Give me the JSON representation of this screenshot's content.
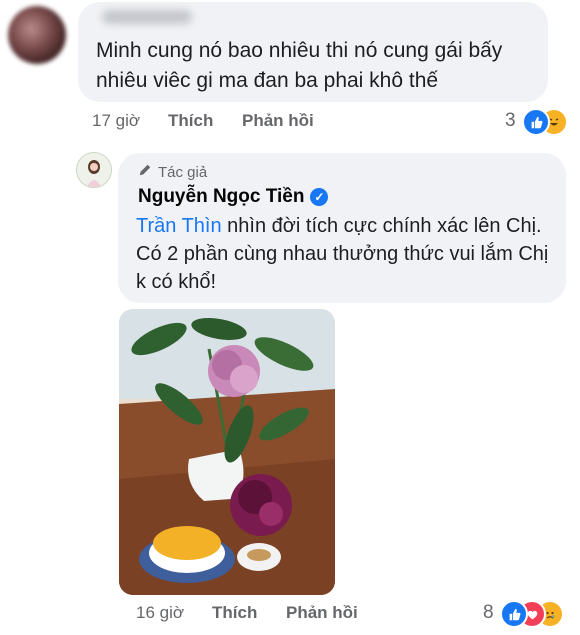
{
  "comment1": {
    "text": "Minh cung nó bao nhiêu thi nó cung gái bấy nhiêu viêc gi ma đan ba phai khô thế",
    "time": "17 giờ",
    "like_label": "Thích",
    "reply_label": "Phản hồi",
    "reaction_count": "3"
  },
  "comment2": {
    "author_tag": "Tác giả",
    "author_name": "Nguyễn Ngọc Tiền",
    "mention": "Trần Thìn",
    "text": " nhìn đời tích cực chính xác lên Chị. Có 2 phần cùng nhau thưởng thức vui lắm Chị k có khổ!",
    "time": "16 giờ",
    "like_label": "Thích",
    "reply_label": "Phản hồi",
    "reaction_count": "8"
  },
  "colors": {
    "accent": "#1877f2",
    "bubble": "#f0f2f5",
    "meta_text": "#65676b"
  },
  "icons": [
    "like-icon",
    "haha-icon",
    "love-icon",
    "sad-icon",
    "pencil-icon",
    "verified-icon"
  ]
}
